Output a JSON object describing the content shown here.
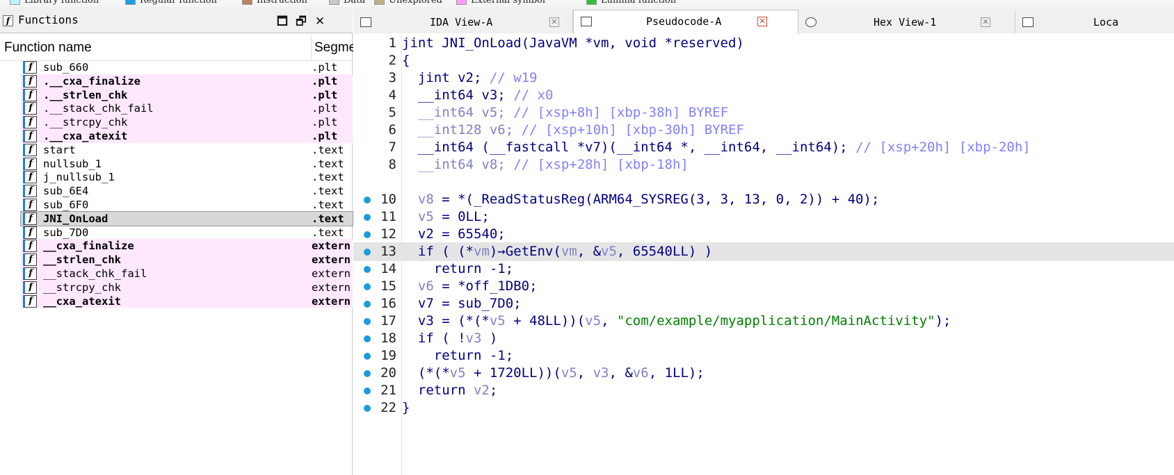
{
  "legend": {
    "items": [
      {
        "label": "Library function",
        "color": "#bff4ff"
      },
      {
        "label": "Regular function",
        "color": "#1f9ce6"
      },
      {
        "label": "Instruction",
        "color": "#c08060"
      },
      {
        "label": "Data",
        "color": "#c8c8c8"
      },
      {
        "label": "Unexplored",
        "color": "#c0b080"
      },
      {
        "label": "External symbol",
        "color": "#ff9eff"
      },
      {
        "label": "Lumina function",
        "color": "#2ec42e"
      }
    ]
  },
  "functions_panel": {
    "title": "Functions",
    "col_name": "Function name",
    "col_segment": "Segme",
    "rows": [
      {
        "name": "sub_660",
        "segment": ".plt",
        "style": "normal"
      },
      {
        "name": ".__cxa_finalize",
        "segment": ".plt",
        "style": "pink-bold"
      },
      {
        "name": ".__strlen_chk",
        "segment": ".plt",
        "style": "pink-bold"
      },
      {
        "name": ".__stack_chk_fail",
        "segment": ".plt",
        "style": "pink"
      },
      {
        "name": ".__strcpy_chk",
        "segment": ".plt",
        "style": "pink"
      },
      {
        "name": ".__cxa_atexit",
        "segment": ".plt",
        "style": "pink-bold"
      },
      {
        "name": "start",
        "segment": ".text",
        "style": "normal"
      },
      {
        "name": "nullsub_1",
        "segment": ".text",
        "style": "normal"
      },
      {
        "name": "j_nullsub_1",
        "segment": ".text",
        "style": "normal"
      },
      {
        "name": "sub_6E4",
        "segment": ".text",
        "style": "normal"
      },
      {
        "name": "sub_6F0",
        "segment": ".text",
        "style": "normal"
      },
      {
        "name": "JNI_OnLoad",
        "segment": ".text",
        "style": "selected-bold"
      },
      {
        "name": "sub_7D0",
        "segment": ".text",
        "style": "normal"
      },
      {
        "name": "__cxa_finalize",
        "segment": "extern",
        "style": "pink-bold"
      },
      {
        "name": "__strlen_chk",
        "segment": "extern",
        "style": "pink-bold"
      },
      {
        "name": "__stack_chk_fail",
        "segment": "extern",
        "style": "pink"
      },
      {
        "name": "__strcpy_chk",
        "segment": "extern",
        "style": "pink"
      },
      {
        "name": "__cxa_atexit",
        "segment": "extern",
        "style": "pink-bold"
      }
    ]
  },
  "tabs": [
    {
      "label": "IDA View-A",
      "active": false
    },
    {
      "label": "Pseudocode-A",
      "active": true
    },
    {
      "label": "Hex View-1",
      "active": false
    },
    {
      "label": "Loca",
      "active": false
    }
  ],
  "code_lines": [
    {
      "num": "1",
      "dot": false,
      "html": "<span class=\"k\">jint JNI_OnLoad(JavaVM *vm, void *reserved)</span>"
    },
    {
      "num": "2",
      "dot": false,
      "html": "<span class=\"k\">{</span>"
    },
    {
      "num": "3",
      "dot": false,
      "html": "  <span class=\"k\">jint v2;</span> <span class=\"c\">// w19</span>"
    },
    {
      "num": "4",
      "dot": false,
      "html": "  <span class=\"k\">__int64 v3;</span> <span class=\"c\">// x0</span>"
    },
    {
      "num": "5",
      "dot": false,
      "html": "  <span class=\"g\">__int64 v5;</span> <span class=\"c\">// [xsp+8h] [xbp-38h] BYREF</span>"
    },
    {
      "num": "6",
      "dot": false,
      "html": "  <span class=\"g\">__int128 v6;</span> <span class=\"c\">// [xsp+10h] [xbp-30h] BYREF</span>"
    },
    {
      "num": "7",
      "dot": false,
      "html": "  <span class=\"k\">__int64 (__fastcall *v7)(__int64 *, __int64, __int64);</span> <span class=\"c\">// [xsp+20h] [xbp-20h]</span>"
    },
    {
      "num": "8",
      "dot": false,
      "html": "  <span class=\"g\">__int64 v8;</span> <span class=\"c\">// [xsp+28h] [xbp-18h]</span>"
    },
    {
      "num": "",
      "dot": false,
      "html": ""
    },
    {
      "num": "10",
      "dot": true,
      "html": "  <span class=\"g\">v8</span> <span class=\"k\">= *(_ReadStatusReg(ARM64_SYSREG(3, 3, 13, 0, 2)) + 40);</span>"
    },
    {
      "num": "11",
      "dot": true,
      "html": "  <span class=\"g\">v5</span> <span class=\"k\">= 0LL;</span>"
    },
    {
      "num": "12",
      "dot": true,
      "html": "  <span class=\"k\">v2 = 65540;</span>"
    },
    {
      "num": "13",
      "dot": true,
      "hl": true,
      "html": "  <span class=\"k\">if ( (*</span><span class=\"g\">vm</span><span class=\"k\">)→GetEnv(</span><span class=\"g\">vm</span><span class=\"k\">, &amp;</span><span class=\"g\">v5</span><span class=\"k\">, 65540LL) )</span>"
    },
    {
      "num": "14",
      "dot": true,
      "html": "    <span class=\"k\">return -1;</span>"
    },
    {
      "num": "15",
      "dot": true,
      "html": "  <span class=\"g\">v6</span> <span class=\"k\">= *off_1DB0;</span>"
    },
    {
      "num": "16",
      "dot": true,
      "html": "  <span class=\"k\">v7 = sub_7D0;</span>"
    },
    {
      "num": "17",
      "dot": true,
      "html": "  <span class=\"k\">v3 = (*(*</span><span class=\"g\">v5</span><span class=\"k\"> + 48LL))(</span><span class=\"g\">v5</span><span class=\"k\">, </span><span class=\"s\">\"com/example/myapplication/MainActivity\"</span><span class=\"k\">);</span>"
    },
    {
      "num": "18",
      "dot": true,
      "html": "  <span class=\"k\">if ( !</span><span class=\"g\">v3</span><span class=\"k\"> )</span>"
    },
    {
      "num": "19",
      "dot": true,
      "html": "    <span class=\"k\">return -1;</span>"
    },
    {
      "num": "20",
      "dot": true,
      "html": "  <span class=\"k\">(*(*</span><span class=\"g\">v5</span><span class=\"k\"> + 1720LL))(</span><span class=\"g\">v5</span><span class=\"k\">, </span><span class=\"g\">v3</span><span class=\"k\">, &amp;</span><span class=\"g\">v6</span><span class=\"k\">, 1LL);</span>"
    },
    {
      "num": "21",
      "dot": true,
      "html": "  <span class=\"k\">return </span><span class=\"g\">v2</span><span class=\"k\">;</span>"
    },
    {
      "num": "22",
      "dot": true,
      "html": "<span class=\"k\">}</span>"
    }
  ]
}
